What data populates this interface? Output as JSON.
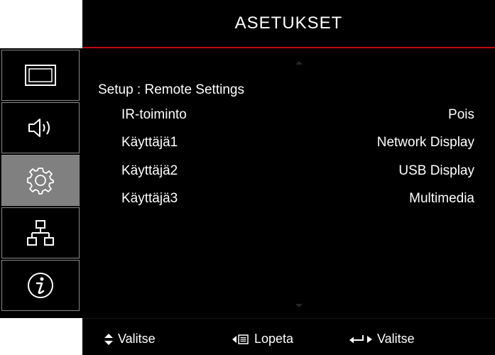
{
  "header": {
    "title": "ASETUKSET"
  },
  "sidebar": {
    "tabs": [
      {
        "icon": "display-icon",
        "active": false
      },
      {
        "icon": "speaker-icon",
        "active": false
      },
      {
        "icon": "gear-icon",
        "active": true
      },
      {
        "icon": "network-icon",
        "active": false
      },
      {
        "icon": "info-icon",
        "active": false
      }
    ]
  },
  "main": {
    "section_title": "Setup : Remote Settings",
    "rows": [
      {
        "label": "IR-toiminto",
        "value": "Pois"
      },
      {
        "label": "Käyttäjä1",
        "value": "Network Display"
      },
      {
        "label": "Käyttäjä2",
        "value": "USB Display"
      },
      {
        "label": "Käyttäjä3",
        "value": "Multimedia"
      }
    ]
  },
  "footer": {
    "hints": [
      {
        "icon": "up-down-arrows-icon",
        "label": "Valitse"
      },
      {
        "icon": "left-arrow-menu-icon",
        "label": "Lopeta"
      },
      {
        "icon": "enter-right-icon",
        "label": "Valitse"
      }
    ]
  },
  "colors": {
    "background": "#000000",
    "accent_line": "#c00a16",
    "active_tab": "#808080",
    "tab_border": "#8a8a8a",
    "text": "#ffffff"
  }
}
